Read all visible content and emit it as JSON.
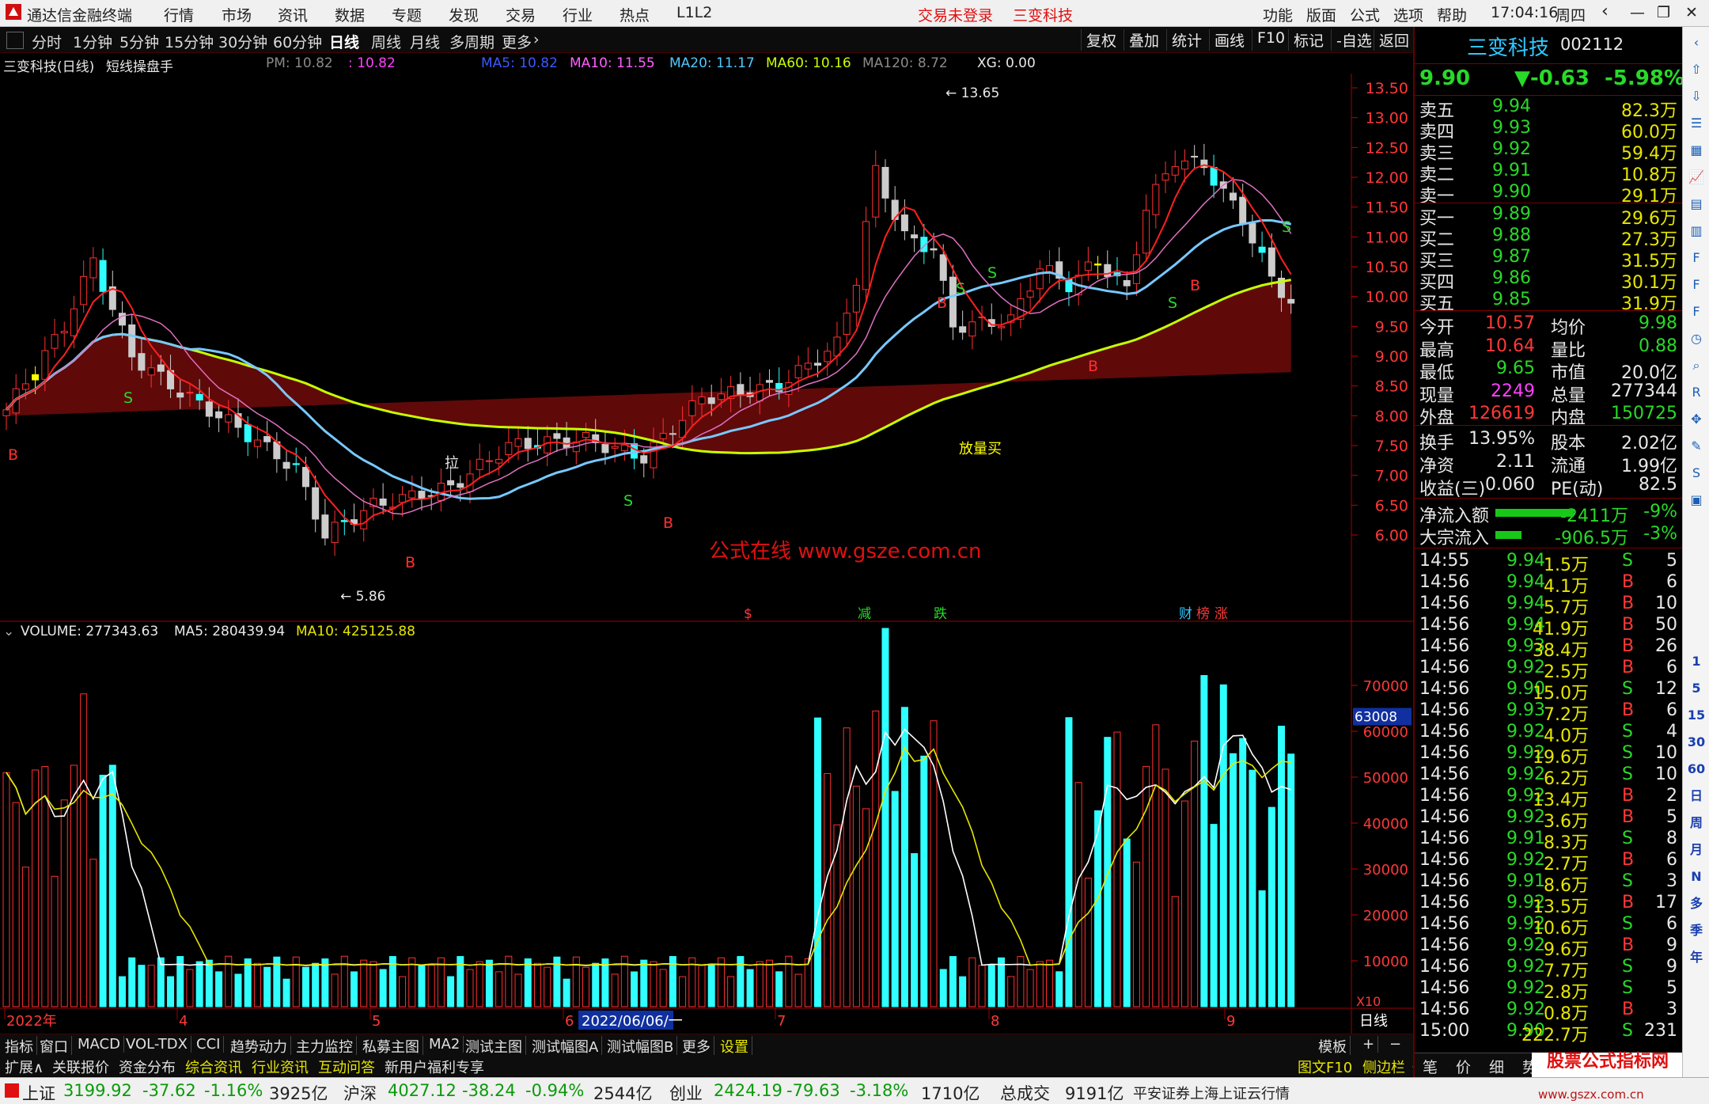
{
  "app": {
    "title": "通达信金融终端",
    "menu": [
      "行情",
      "市场",
      "资讯",
      "数据",
      "专题",
      "发现",
      "交易",
      "行业",
      "热点",
      "L1L2"
    ],
    "login_status": "交易未登录",
    "stock_name_top": "三变科技",
    "right_menu": [
      "功能",
      "版面",
      "公式",
      "选项",
      "帮助"
    ],
    "clock": "17:04:16",
    "weekday": "周四"
  },
  "timeframes": [
    "分时",
    "1分钟",
    "5分钟",
    "15分钟",
    "30分钟",
    "60分钟",
    "日线",
    "周线",
    "月线",
    "多周期",
    "更多"
  ],
  "active_timeframe": "日线",
  "toolbar_right": [
    "复权",
    "叠加",
    "统计",
    "画线",
    "F10",
    "标记",
    "-自选",
    "返回"
  ],
  "chart_header": {
    "title": "三变科技(日线)",
    "indicator": "短线操盘手",
    "pm": "PM: 10.82",
    "pm2": ": 10.82",
    "ma5": "MA5: 10.82",
    "ma10": "MA10: 11.55",
    "ma20": "MA20: 11.17",
    "ma60": "MA60: 10.16",
    "ma120": "MA120: 8.72",
    "xg": "XG: 0.00"
  },
  "price_axis": [
    "13.50",
    "13.00",
    "12.50",
    "12.00",
    "11.50",
    "11.00",
    "10.50",
    "10.00",
    "9.50",
    "9.00",
    "8.50",
    "8.00",
    "7.50",
    "7.00",
    "6.50",
    "6.00"
  ],
  "annotations": {
    "high": "13.65",
    "low": "5.86",
    "la": "拉",
    "fangliang": "放量买",
    "watermark": "公式在线  www.gsze.com.cn",
    "events": [
      "$",
      "减",
      "跌",
      "财",
      "榜",
      "涨"
    ],
    "buy": "B",
    "sell": "S"
  },
  "volume_header": {
    "label": "VOLUME: 277343.63",
    "ma5": "MA5: 280439.94",
    "ma10": "MA10: 425125.88"
  },
  "volume_axis": [
    "70000",
    "60000",
    "50000",
    "40000",
    "30000",
    "20000",
    "10000"
  ],
  "volume_marker": "63008",
  "volume_unit": "X10",
  "date_axis": {
    "labels": [
      "2022年",
      "4",
      "5",
      "6",
      "7",
      "8",
      "9"
    ],
    "highlight": "2022/06/06/一",
    "period": "日线"
  },
  "indicator_tabs": [
    "指标",
    "窗口",
    "MACD",
    "VOL-TDX",
    "CCI",
    "趋势动力",
    "主力监控",
    "私募主图",
    "MA2",
    "测试主图",
    "测试幅图A",
    "测试幅图B",
    "更多",
    "设置"
  ],
  "template_tab": "模板",
  "bottom_tabs": [
    "扩展∧",
    "关联报价",
    "资金分布",
    "综合资讯",
    "行业资讯",
    "互动问答",
    "新用户福利专享"
  ],
  "bottom_right": [
    "图文F10",
    "侧边栏《",
    "笔",
    "价",
    "细",
    "势"
  ],
  "status": {
    "sh_label": "上证",
    "sh_val": "3199.92",
    "sh_chg": "-37.62",
    "sh_pct": "-1.16%",
    "sh_amt": "3925亿",
    "hs_label": "沪深",
    "hs_val": "4027.12",
    "hs_chg": "-38.24",
    "hs_pct": "-0.94%",
    "hs_amt": "2544亿",
    "cy_label": "创业",
    "cy_val": "2424.19",
    "cy_chg": "-79.63",
    "cy_pct": "-3.18%",
    "cy_amt": "1710亿",
    "total_label": "总成交",
    "total_amt": "9191亿",
    "broker": "平安证券上海上证云行情"
  },
  "quote": {
    "name": "三变科技",
    "code": "002112",
    "price": "9.90",
    "change": "▼-0.63",
    "pct": "-5.98%",
    "asks": [
      {
        "label": "卖五",
        "price": "9.94",
        "vol": "82.3万"
      },
      {
        "label": "卖四",
        "price": "9.93",
        "vol": "60.0万"
      },
      {
        "label": "卖三",
        "price": "9.92",
        "vol": "59.4万"
      },
      {
        "label": "卖二",
        "price": "9.91",
        "vol": "10.8万"
      },
      {
        "label": "卖一",
        "price": "9.90",
        "vol": "29.1万"
      }
    ],
    "bids": [
      {
        "label": "买一",
        "price": "9.89",
        "vol": "29.6万"
      },
      {
        "label": "买二",
        "price": "9.88",
        "vol": "27.3万"
      },
      {
        "label": "买三",
        "price": "9.87",
        "vol": "31.5万"
      },
      {
        "label": "买四",
        "price": "9.86",
        "vol": "30.1万"
      },
      {
        "label": "买五",
        "price": "9.85",
        "vol": "31.9万"
      }
    ],
    "stats": [
      {
        "l1": "今开",
        "v1": "10.57",
        "c1": "up",
        "l2": "均价",
        "v2": "9.98",
        "c2": "dn"
      },
      {
        "l1": "最高",
        "v1": "10.64",
        "c1": "up",
        "l2": "量比",
        "v2": "0.88",
        "c2": "dn"
      },
      {
        "l1": "最低",
        "v1": "9.65",
        "c1": "dn",
        "l2": "市值",
        "v2": "20.0亿",
        "c2": "wh"
      },
      {
        "l1": "现量",
        "v1": "2249",
        "c1": "pu",
        "l2": "总量",
        "v2": "277344",
        "c2": "wh"
      },
      {
        "l1": "外盘",
        "v1": "126619",
        "c1": "up",
        "l2": "内盘",
        "v2": "150725",
        "c2": "dn"
      }
    ],
    "stats2": [
      {
        "l1": "换手",
        "v1": "13.95%",
        "l2": "股本",
        "v2": "2.02亿"
      },
      {
        "l1": "净资",
        "v1": "2.11",
        "l2": "流通",
        "v2": "1.99亿"
      },
      {
        "l1": "收益(三)",
        "v1": "0.060",
        "l2": "PE(动)",
        "v2": "82.5"
      }
    ],
    "flows": [
      {
        "label": "净流入额",
        "val": "-2411万",
        "pct": "-9%",
        "bar": 0.9
      },
      {
        "label": "大宗流入",
        "val": "-906.5万",
        "pct": "-3%",
        "bar": 0.3
      }
    ],
    "ticks": [
      {
        "t": "14:55",
        "p": "9.94",
        "v": "1.5万",
        "s": "S",
        "n": "5"
      },
      {
        "t": "14:56",
        "p": "9.94",
        "v": "4.1万",
        "s": "B",
        "n": "6"
      },
      {
        "t": "14:56",
        "p": "9.94",
        "v": "5.7万",
        "s": "B",
        "n": "10"
      },
      {
        "t": "14:56",
        "p": "9.94",
        "v": "41.9万",
        "s": "B",
        "n": "50"
      },
      {
        "t": "14:56",
        "p": "9.93",
        "v": "38.4万",
        "s": "B",
        "n": "26"
      },
      {
        "t": "14:56",
        "p": "9.92",
        "v": "2.5万",
        "s": "B",
        "n": "6"
      },
      {
        "t": "14:56",
        "p": "9.90",
        "v": "15.0万",
        "s": "S",
        "n": "12"
      },
      {
        "t": "14:56",
        "p": "9.93",
        "v": "7.2万",
        "s": "B",
        "n": "6"
      },
      {
        "t": "14:56",
        "p": "9.92",
        "v": "4.0万",
        "s": "S",
        "n": "4"
      },
      {
        "t": "14:56",
        "p": "9.92",
        "v": "19.6万",
        "s": "S",
        "n": "10"
      },
      {
        "t": "14:56",
        "p": "9.92",
        "v": "6.2万",
        "s": "S",
        "n": "10"
      },
      {
        "t": "14:56",
        "p": "9.92",
        "v": "13.4万",
        "s": "B",
        "n": "2"
      },
      {
        "t": "14:56",
        "p": "9.92",
        "v": "3.6万",
        "s": "B",
        "n": "5"
      },
      {
        "t": "14:56",
        "p": "9.91",
        "v": "8.3万",
        "s": "S",
        "n": "8"
      },
      {
        "t": "14:56",
        "p": "9.92",
        "v": "2.7万",
        "s": "B",
        "n": "6"
      },
      {
        "t": "14:56",
        "p": "9.91",
        "v": "8.6万",
        "s": "S",
        "n": "3"
      },
      {
        "t": "14:56",
        "p": "9.92",
        "v": "13.5万",
        "s": "B",
        "n": "17"
      },
      {
        "t": "14:56",
        "p": "9.92",
        "v": "10.6万",
        "s": "S",
        "n": "6"
      },
      {
        "t": "14:56",
        "p": "9.92",
        "v": "9.6万",
        "s": "B",
        "n": "9"
      },
      {
        "t": "14:56",
        "p": "9.92",
        "v": "7.7万",
        "s": "S",
        "n": "9"
      },
      {
        "t": "14:56",
        "p": "9.92",
        "v": "2.8万",
        "s": "S",
        "n": "5"
      },
      {
        "t": "14:56",
        "p": "9.92",
        "v": "0.8万",
        "s": "B",
        "n": "3"
      },
      {
        "t": "15:00",
        "p": "9.90",
        "v": "222.7万",
        "s": "S",
        "n": "231"
      }
    ]
  },
  "side_period_tabs": [
    "1",
    "5",
    "15",
    "30",
    "60",
    "日",
    "周",
    "月",
    "N",
    "多",
    "季",
    "年"
  ],
  "brand_watermark": "股票公式指标网",
  "brand_url": "www.gszx.com.cn",
  "colors": {
    "up": "#ff3030",
    "down": "#30ffff",
    "ma5": "#ffffff",
    "ma10": "#ff00ff",
    "ma20": "#5ac8ff",
    "ma60": "#c8ff00",
    "bg": "#000000"
  }
}
